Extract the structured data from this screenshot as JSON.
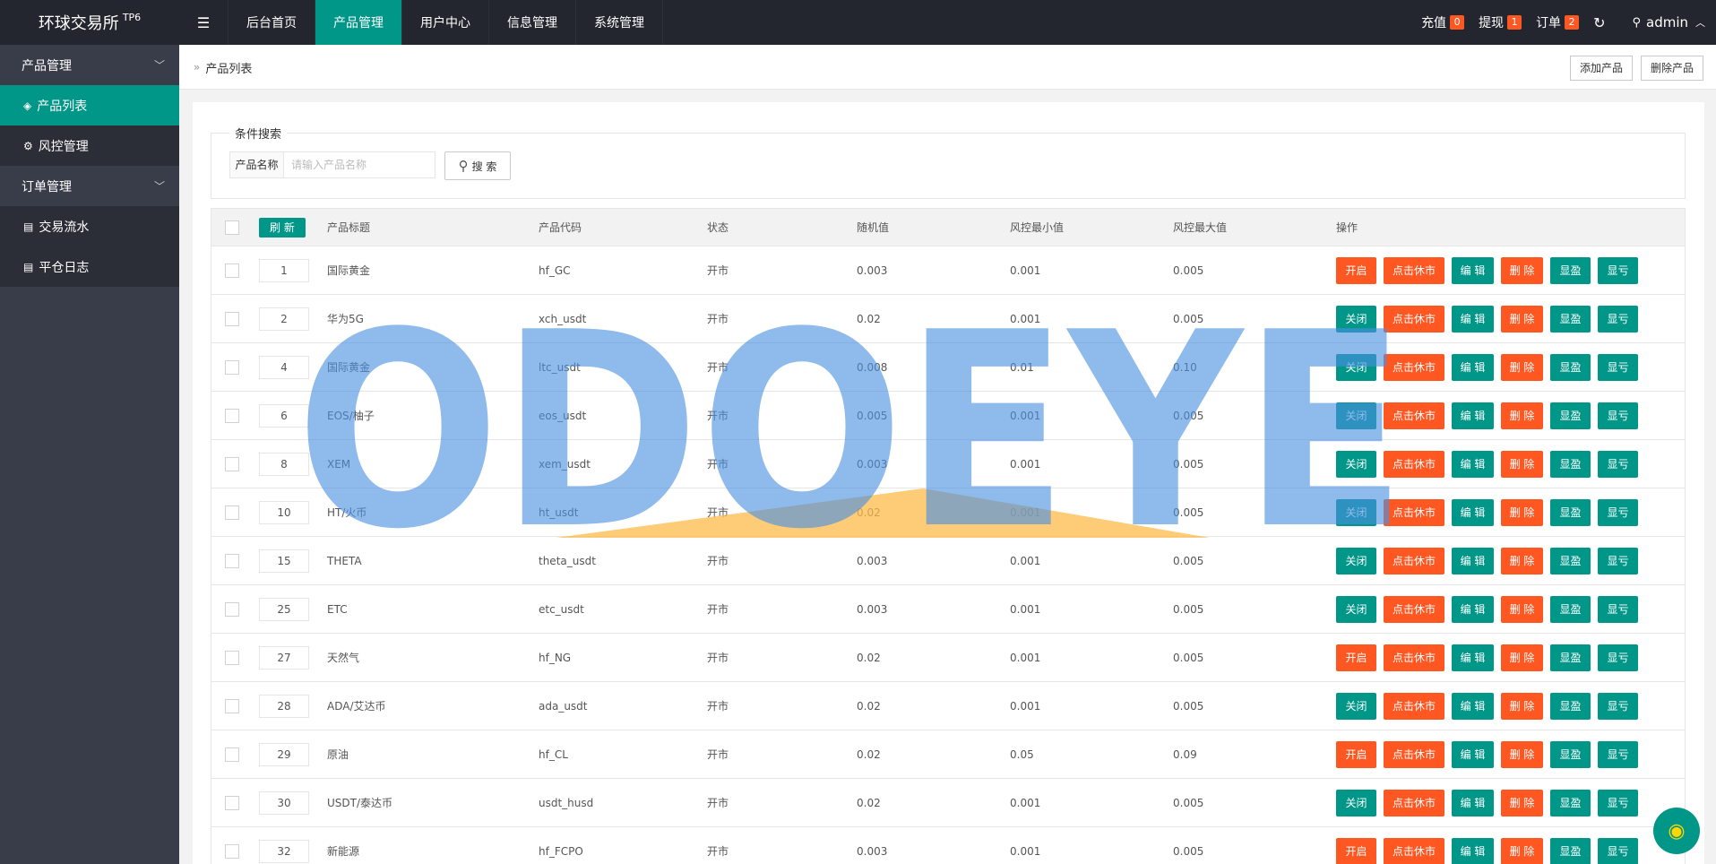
{
  "header": {
    "logo": "环球交易所",
    "logo_sup": "TP6",
    "toggle": "☰",
    "nav": [
      "后台首页",
      "产品管理",
      "用户中心",
      "信息管理",
      "系统管理"
    ],
    "recharge": "充值",
    "recharge_count": "0",
    "withdraw": "提现",
    "withdraw_count": "1",
    "orders": "订单",
    "orders_count": "2",
    "user": "admin"
  },
  "sidebar": {
    "group1": "产品管理",
    "item1": "产品列表",
    "item2": "风控管理",
    "group2": "订单管理",
    "item3": "交易流水",
    "item4": "平仓日志"
  },
  "breadcrumb": "产品列表",
  "toolbar": {
    "add": "添加产品",
    "delete": "删除产品"
  },
  "search": {
    "legend": "条件搜索",
    "label": "产品名称",
    "placeholder": "请输入产品名称",
    "button": "搜 索"
  },
  "table": {
    "refresh": "刷 新",
    "headers": [
      "产品标题",
      "产品代码",
      "状态",
      "随机值",
      "风控最小值",
      "风控最大值",
      "操作"
    ],
    "buttons": {
      "pause": "点击休市",
      "edit": "编 辑",
      "delete": "删 除",
      "profit": "显盈",
      "loss": "显亏"
    },
    "rows": [
      {
        "sort": "1",
        "title": "国际黄金",
        "code": "hf_GC",
        "status": "开市",
        "random": "0.003",
        "min": "0.001",
        "max": "0.005",
        "toggle": "开启"
      },
      {
        "sort": "2",
        "title": "华为5G",
        "code": "xch_usdt",
        "status": "开市",
        "random": "0.02",
        "min": "0.001",
        "max": "0.005",
        "toggle": "关闭"
      },
      {
        "sort": "4",
        "title": "国际黄金",
        "code": "ltc_usdt",
        "status": "开市",
        "random": "0.008",
        "min": "0.01",
        "max": "0.10",
        "toggle": "关闭"
      },
      {
        "sort": "6",
        "title": "EOS/柚子",
        "code": "eos_usdt",
        "status": "开市",
        "random": "0.005",
        "min": "0.001",
        "max": "0.005",
        "toggle": "关闭"
      },
      {
        "sort": "8",
        "title": "XEM",
        "code": "xem_usdt",
        "status": "开市",
        "random": "0.003",
        "min": "0.001",
        "max": "0.005",
        "toggle": "关闭"
      },
      {
        "sort": "10",
        "title": "HT/火币",
        "code": "ht_usdt",
        "status": "开市",
        "random": "0.02",
        "min": "0.001",
        "max": "0.005",
        "toggle": "关闭"
      },
      {
        "sort": "15",
        "title": "THETA",
        "code": "theta_usdt",
        "status": "开市",
        "random": "0.003",
        "min": "0.001",
        "max": "0.005",
        "toggle": "关闭"
      },
      {
        "sort": "25",
        "title": "ETC",
        "code": "etc_usdt",
        "status": "开市",
        "random": "0.003",
        "min": "0.001",
        "max": "0.005",
        "toggle": "关闭"
      },
      {
        "sort": "27",
        "title": "天然气",
        "code": "hf_NG",
        "status": "开市",
        "random": "0.02",
        "min": "0.001",
        "max": "0.005",
        "toggle": "开启"
      },
      {
        "sort": "28",
        "title": "ADA/艾达币",
        "code": "ada_usdt",
        "status": "开市",
        "random": "0.02",
        "min": "0.001",
        "max": "0.005",
        "toggle": "关闭"
      },
      {
        "sort": "29",
        "title": "原油",
        "code": "hf_CL",
        "status": "开市",
        "random": "0.02",
        "min": "0.05",
        "max": "0.09",
        "toggle": "开启"
      },
      {
        "sort": "30",
        "title": "USDT/泰达币",
        "code": "usdt_husd",
        "status": "开市",
        "random": "0.02",
        "min": "0.001",
        "max": "0.005",
        "toggle": "关闭"
      },
      {
        "sort": "32",
        "title": "新能源",
        "code": "hf_FCPO",
        "status": "开市",
        "random": "0.003",
        "min": "0.001",
        "max": "0.005",
        "toggle": "开启"
      }
    ]
  },
  "watermark": "ODOEYE"
}
